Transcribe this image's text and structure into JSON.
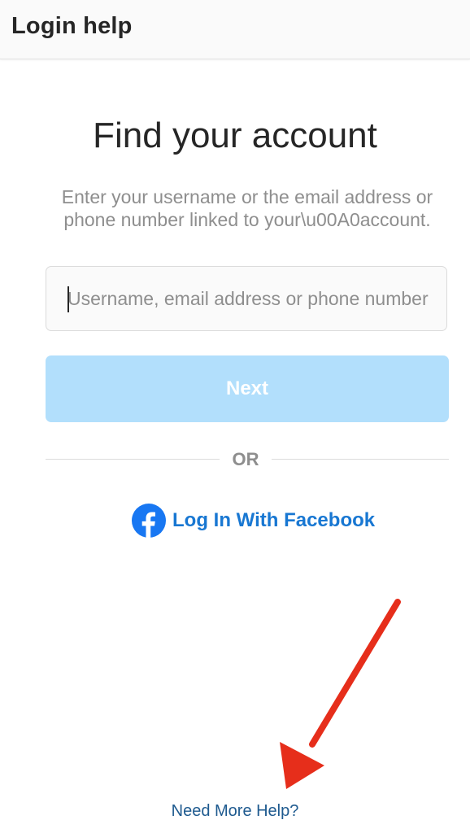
{
  "header": {
    "title": "Login help"
  },
  "main": {
    "title": "Find your account",
    "subtitle": "Enter your username or the email address or phone number linked to your\\u00A0account.",
    "input": {
      "placeholder": "Username, email address or phone number",
      "value": ""
    },
    "next_label": "Next",
    "or_label": "OR",
    "facebook_label": "Log In With Facebook"
  },
  "footer": {
    "help_label": "Need More Help?"
  },
  "colors": {
    "accent": "#0095f6",
    "button_disabled": "#b2dffc",
    "facebook": "#1877f2",
    "annotation_arrow": "#e62e1b"
  },
  "icons": {
    "facebook": "facebook-icon",
    "annotation": "red-arrow-annotation"
  }
}
